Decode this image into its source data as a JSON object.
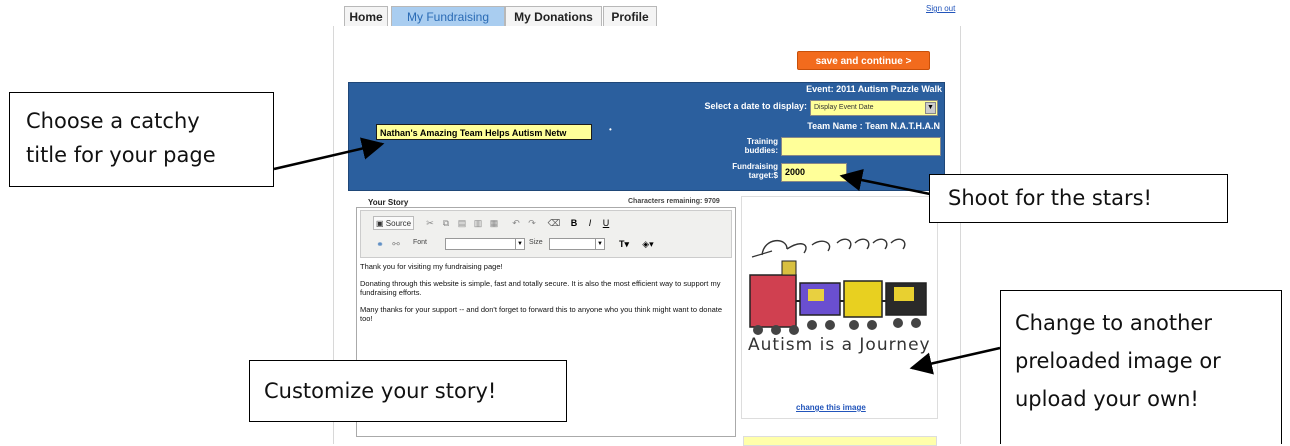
{
  "nav": {
    "tabs": [
      "Home",
      "My Fundraising",
      "My Donations",
      "Profile"
    ],
    "active_tab": "My Fundraising",
    "sign_out": "Sign out"
  },
  "save_button": "save and continue >",
  "header": {
    "event": "Event: 2011 Autism Puzzle Walk",
    "date_label": "Select a date to display:",
    "date_value": "Display Event Date",
    "team_name": "Team Name : Team N.A.T.H.A.N",
    "page_title_value": "Nathan's Amazing Team Helps Autism Netw",
    "training_label": "Training\nbuddies:",
    "training_value": "",
    "target_label": "Fundraising\ntarget:$",
    "target_value": "2000"
  },
  "story": {
    "label": "Your Story",
    "chars_remaining": "Characters remaining: 9709",
    "toolbar": {
      "source": "Source",
      "font_label": "Font",
      "size_label": "Size"
    },
    "paragraphs": [
      "Thank you for visiting my fundraising page!",
      "Donating through this website is simple, fast and totally secure. It is also the most efficient way to support my fundraising efforts.",
      "Many thanks for your support -- and don't forget to forward this to anyone who you think might want to donate too!"
    ]
  },
  "image": {
    "caption": "Autism is a Journey",
    "change_link": "change this image"
  },
  "callouts": {
    "title": "Choose a catchy title for your page",
    "title_line1": "Choose a catchy",
    "title_line2": "title for your page",
    "stars": "Shoot for the stars!",
    "story": "Customize your story!",
    "image_line1": "Change to another",
    "image_line2": "preloaded image or",
    "image_line3": "upload your own!"
  },
  "colors": {
    "header_blue": "#2b5f9e",
    "field_yellow": "#ffff99",
    "save_orange": "#f26b1d",
    "active_tab": "#a9cdf0"
  }
}
